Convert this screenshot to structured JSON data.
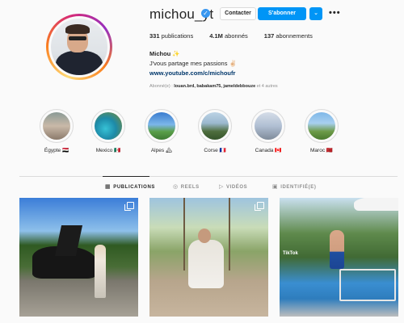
{
  "profile": {
    "username": "michou_yt",
    "full_name": "Michou",
    "name_emoji": "✨",
    "bio": "J'vous partage mes passions",
    "bio_emoji": "✌🏻",
    "link": "www.youtube.com/c/michoufr",
    "followed_by_prefix": "Abonné(e) : ",
    "followed_by_names": "louan.brd, babakam75, jameldebbouze",
    "followed_by_suffix": " et 4 autres"
  },
  "buttons": {
    "contact": "Contacter",
    "follow": "S'abonner",
    "more": "⌄",
    "options": "•••"
  },
  "stats": {
    "posts_count": "331",
    "posts_label": "publications",
    "followers_count": "4.1M",
    "followers_label": "abonnés",
    "following_count": "137",
    "following_label": "abonnements"
  },
  "highlights": [
    {
      "label": "Égypte 🇪🇬"
    },
    {
      "label": "Mexico 🇲🇽"
    },
    {
      "label": "Alpes 🏔"
    },
    {
      "label": "Corse 🇫🇷"
    },
    {
      "label": "Canada 🇨🇦"
    },
    {
      "label": "Maroc 🇲🇦"
    }
  ],
  "tabs": [
    {
      "label": "PUBLICATIONS",
      "icon": "▦"
    },
    {
      "label": "REELS",
      "icon": "◎"
    },
    {
      "label": "VIDÉOS",
      "icon": "▷"
    },
    {
      "label": "IDENTIFIÉ(E)",
      "icon": "▣"
    }
  ],
  "posts": [
    {
      "overlay": ""
    },
    {
      "overlay": ""
    },
    {
      "overlay": "TikTok"
    }
  ],
  "colors": {
    "accent": "#0095f6",
    "verified": "#3897f0",
    "link": "#00376b",
    "muted": "#8e8e8e"
  }
}
